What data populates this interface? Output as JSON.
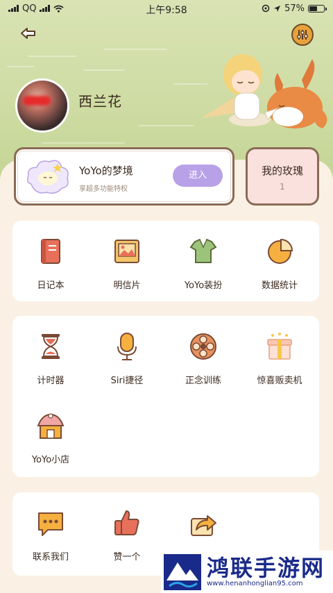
{
  "status_bar": {
    "carrier": "QQ",
    "time": "上午9:58",
    "battery": "57%",
    "battery_level": 0.57
  },
  "profile": {
    "username": "西兰花"
  },
  "dream_card": {
    "title": "YoYo的梦境",
    "subtitle": "享超多功能特权",
    "enter_label": "进入"
  },
  "rose_card": {
    "title": "我的玫瑰",
    "count": "1"
  },
  "section1": {
    "items": [
      {
        "label": "日记本",
        "icon": "diary-icon"
      },
      {
        "label": "明信片",
        "icon": "postcard-icon"
      },
      {
        "label": "YoYo装扮",
        "icon": "dress-up-icon"
      },
      {
        "label": "数据统计",
        "icon": "statistics-icon"
      }
    ]
  },
  "section2": {
    "items": [
      {
        "label": "计时器",
        "icon": "hourglass-icon"
      },
      {
        "label": "Siri捷径",
        "icon": "microphone-icon"
      },
      {
        "label": "正念训练",
        "icon": "flower-icon"
      },
      {
        "label": "惊喜贩卖机",
        "icon": "gift-box-icon"
      },
      {
        "label": "YoYo小店",
        "icon": "shop-icon"
      }
    ]
  },
  "section3": {
    "items": [
      {
        "label": "联系我们",
        "icon": "chat-icon"
      },
      {
        "label": "赞一个",
        "icon": "thumbs-up-icon"
      },
      {
        "label": "",
        "icon": "share-icon"
      }
    ]
  },
  "watermark": {
    "title": "鸿联手游网",
    "url": "www.henanhonglian95.com"
  },
  "colors": {
    "hero_green": "#cfdca4",
    "background": "#faf1e4",
    "enter_button": "#b9a1e8",
    "rose_card": "#fbe1de",
    "accent_orange": "#e8a23a"
  }
}
